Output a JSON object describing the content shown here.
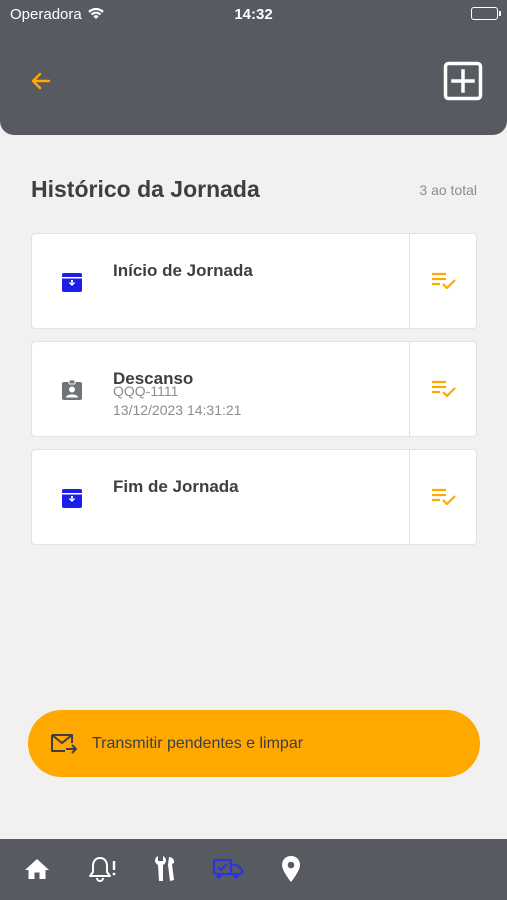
{
  "status_bar": {
    "carrier": "Operadora",
    "time": "14:32"
  },
  "header": {
    "back_icon": "arrow-left-icon",
    "add_icon": "plus-square-icon"
  },
  "section": {
    "title": "Histórico da Jornada",
    "count": "3 ao total"
  },
  "items": [
    {
      "title": "Início de Jornada",
      "icon": "archive-down-icon",
      "action_icon": "list-check-icon"
    },
    {
      "title": "Descanso",
      "plate": "QQQ-1111",
      "datetime": "13/12/2023 14:31:21",
      "icon": "badge-icon",
      "action_icon": "list-check-icon"
    },
    {
      "title": "Fim de Jornada",
      "icon": "archive-down-icon",
      "action_icon": "list-check-icon"
    }
  ],
  "transmit_button": {
    "label": "Transmitir pendentes e limpar",
    "icon": "mail-forward-icon"
  },
  "tabs": [
    {
      "icon": "home-icon",
      "active": false
    },
    {
      "icon": "bell-alert-icon",
      "active": false
    },
    {
      "icon": "tools-icon",
      "active": false
    },
    {
      "icon": "truck-check-icon",
      "active": true
    },
    {
      "icon": "map-pin-icon",
      "active": false
    }
  ],
  "colors": {
    "accent": "#ffa800",
    "header": "#575a60",
    "active_tab": "#2b34e0",
    "blue_icon": "#1b1ee6"
  }
}
